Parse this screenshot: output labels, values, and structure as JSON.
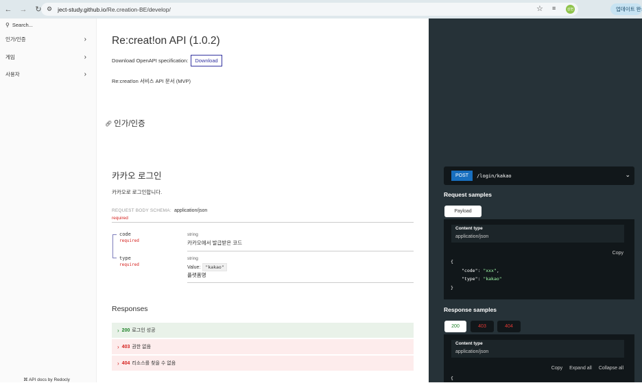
{
  "browser": {
    "back_icon": "arrow-left",
    "forward_icon": "arrow-right",
    "reload_icon": "reload",
    "url_host": "ject-study.github.io",
    "url_path": "/Re.creation-BE/develop/",
    "update_label": "업데이트 완료",
    "avatar_initial": "상현"
  },
  "sidebar": {
    "search_placeholder": "Search...",
    "items": [
      {
        "label": "인가/인증"
      },
      {
        "label": "게임"
      },
      {
        "label": "사용자"
      }
    ],
    "footer": "API docs by Redocly"
  },
  "main": {
    "title": "Re:creat!on API (1.0.2)",
    "download_text": "Download OpenAPI specification:",
    "download_button": "Download",
    "description": "Re:creat!on 서비스 API 문서 (MVP)",
    "section_title": "인가/인증",
    "operation": {
      "title": "카카오 로그인",
      "description": "카카오로 로그인합니다.",
      "body_label": "REQUEST BODY SCHEMA:",
      "body_type": "application/json",
      "body_required": "required",
      "params": [
        {
          "name": "code",
          "required": "required",
          "type": "string",
          "description": "카카오에서 발급받은 코드"
        },
        {
          "name": "type",
          "required": "required",
          "type": "string",
          "value_label": "Value:",
          "value": "\"kakao\"",
          "description": "플랫폼명"
        }
      ]
    },
    "responses_title": "Responses",
    "responses": [
      {
        "code": "200",
        "text": "로그인 성공"
      },
      {
        "code": "403",
        "text": "권한 없음"
      },
      {
        "code": "404",
        "text": "리소스를 찾을 수 없음"
      }
    ]
  },
  "right": {
    "method": "POST",
    "path": "/login/kakao",
    "request_samples_title": "Request samples",
    "payload_tab": "Payload",
    "content_type_label": "Content type",
    "content_type_value": "application/json",
    "copy": "Copy",
    "expand_all": "Expand all",
    "collapse_all": "Collapse all",
    "request_json": {
      "open": "{",
      "k1": "\"code\"",
      "v1": "\"xxx\"",
      "k2": "\"type\"",
      "v2": "\"kakao\"",
      "close": "}"
    },
    "response_samples_title": "Response samples",
    "response_tabs": [
      "200",
      "403",
      "404"
    ],
    "response_json_open": "{"
  },
  "colors": {
    "accent": "#32329f",
    "method_post": "#186fbf",
    "success": "#1d8127",
    "error": "#d41f1c",
    "right_panel": "#263238"
  }
}
